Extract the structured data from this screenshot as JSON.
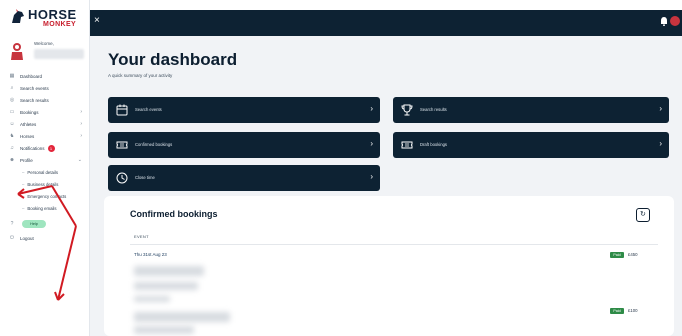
{
  "brand": {
    "word1": "HORSE",
    "word2": "MONKEY"
  },
  "sidebar": {
    "welcome": "Welcome,",
    "items": [
      {
        "label": "Dashboard",
        "icon": "grid-icon",
        "has_chevron": false
      },
      {
        "label": "Search events",
        "icon": "search-icon",
        "has_chevron": false
      },
      {
        "label": "Search results",
        "icon": "results-icon",
        "has_chevron": false
      },
      {
        "label": "Bookings",
        "icon": "ticket-icon",
        "has_chevron": true
      },
      {
        "label": "Athletes",
        "icon": "person-icon",
        "has_chevron": true
      },
      {
        "label": "Horses",
        "icon": "horse-icon",
        "has_chevron": true
      },
      {
        "label": "Notifications",
        "icon": "bell-icon",
        "has_chevron": false,
        "badge": "1"
      },
      {
        "label": "Profile",
        "icon": "user-icon",
        "has_chevron": true
      }
    ],
    "profile_sub": [
      {
        "label": "Personal details"
      },
      {
        "label": "Business details"
      },
      {
        "label": "Emergency contacts"
      },
      {
        "label": "Booking emails"
      }
    ],
    "help": "Help",
    "logout": "Logout"
  },
  "topbar": {
    "close": "×"
  },
  "main": {
    "title": "Your dashboard",
    "subtitle": "A quick summary of your activity",
    "cards": [
      {
        "label": "Search events",
        "icon": "calendar-icon"
      },
      {
        "label": "Search results",
        "icon": "trophy-icon"
      },
      {
        "label": "Confirmed bookings",
        "icon": "ticket-icon"
      },
      {
        "label": "Draft bookings",
        "icon": "ticket-icon"
      },
      {
        "label": "Close time",
        "icon": "clock-icon"
      }
    ],
    "chevron": "›",
    "panel": {
      "title": "Confirmed bookings",
      "col_event": "EVENT",
      "rows": [
        {
          "date": "Thu 31st Aug 23",
          "status": "Paid",
          "amount": "£450"
        },
        {
          "date": "",
          "status": "Paid",
          "amount": "£100"
        }
      ]
    }
  },
  "colors": {
    "navy": "#0d2233",
    "accent_red": "#e3263b",
    "paid_green": "#2e8b47",
    "help_green": "#9fe5bf"
  }
}
